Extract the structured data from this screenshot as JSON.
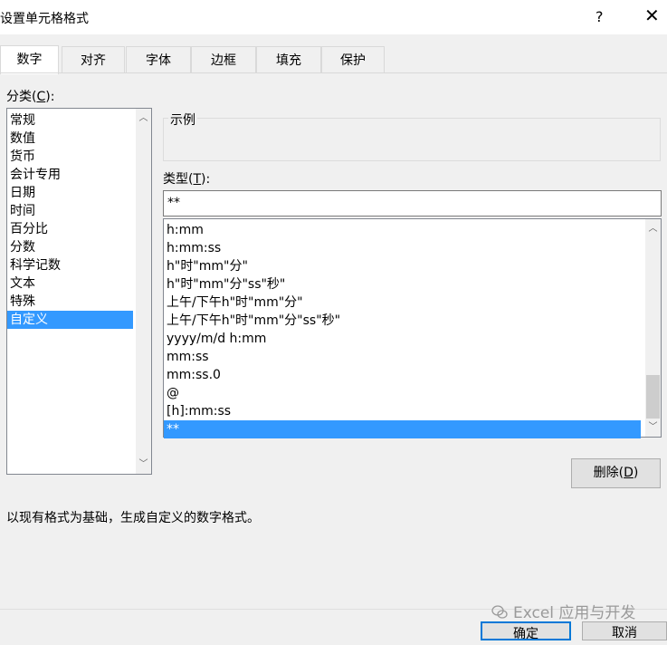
{
  "dialog": {
    "title": "设置单元格格式",
    "help": "?",
    "close": "✕"
  },
  "tabs": [
    "数字",
    "对齐",
    "字体",
    "边框",
    "填充",
    "保护"
  ],
  "category": {
    "label_prefix": "分类(",
    "label_key": "C",
    "label_suffix": "):",
    "items": [
      "常规",
      "数值",
      "货币",
      "会计专用",
      "日期",
      "时间",
      "百分比",
      "分数",
      "科学记数",
      "文本",
      "特殊",
      "自定义"
    ],
    "selected": "自定义"
  },
  "sample": {
    "label": "示例"
  },
  "type": {
    "label_prefix": "类型(",
    "label_key": "T",
    "label_suffix": "):",
    "value": "**",
    "formats": [
      "h:mm",
      "h:mm:ss",
      "h\"时\"mm\"分\"",
      "h\"时\"mm\"分\"ss\"秒\"",
      "上午/下午h\"时\"mm\"分\"",
      "上午/下午h\"时\"mm\"分\"ss\"秒\"",
      "yyyy/m/d h:mm",
      "mm:ss",
      "mm:ss.0",
      "@",
      "[h]:mm:ss",
      "**"
    ],
    "selected": "**"
  },
  "buttons": {
    "delete_prefix": "删除(",
    "delete_key": "D",
    "delete_suffix": ")",
    "ok": "确定",
    "cancel": "取消"
  },
  "description": "以现有格式为基础，生成自定义的数字格式。",
  "watermark": "Excel 应用与开发",
  "colors": {
    "selection": "#3399ff",
    "default_button_border": "#0078d7",
    "background": "#f0f0f0"
  }
}
